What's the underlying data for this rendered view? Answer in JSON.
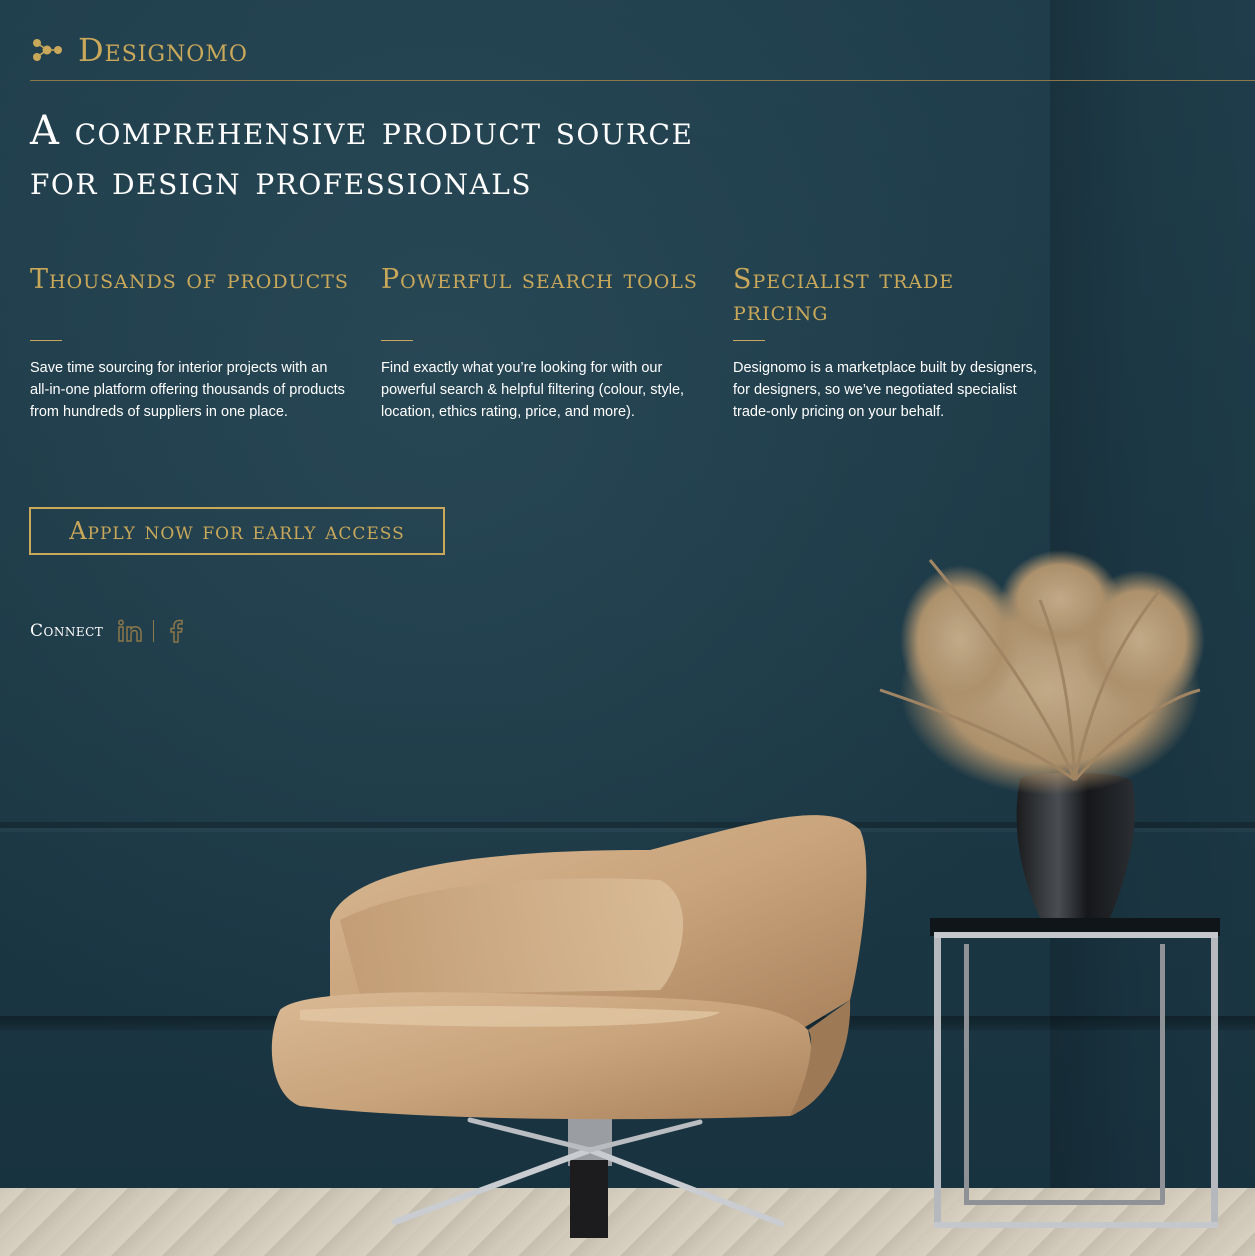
{
  "brand": {
    "name": "Designomo",
    "logo_icon": "designomo-dots-logo"
  },
  "hero": {
    "line1": "A comprehensive product source",
    "line2": "for design professionals"
  },
  "features": [
    {
      "title": "Thousands of products",
      "text": "Save time sourcing for interior projects with an all-in-one platform offering thousands of products from hundreds of suppliers in one place."
    },
    {
      "title": "Powerful search tools",
      "text": "Find exactly what you’re looking for with our powerful search & helpful filtering (colour, style, location, ethics rating, price, and more)."
    },
    {
      "title": "Specialist trade pricing",
      "text": "Designomo is a marketplace built by designers, for designers, so we’ve negotiated specialist trade-only pricing on your behalf."
    }
  ],
  "cta": {
    "label": "Apply now for early access"
  },
  "connect": {
    "label": "Connect",
    "icons": [
      "linkedin-icon",
      "facebook-icon"
    ]
  },
  "colors": {
    "accent_gold": "#c9a85a",
    "background_teal": "#1e3a46",
    "text_white": "#ffffff"
  }
}
